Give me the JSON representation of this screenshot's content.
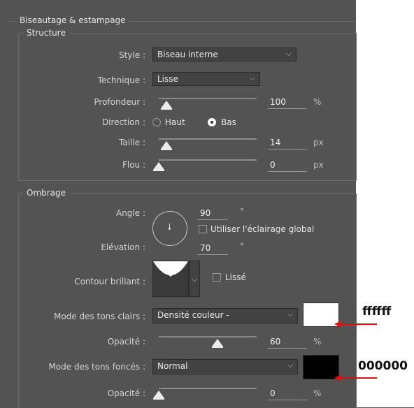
{
  "section": {
    "title": "Biseautage & estampage",
    "structure": {
      "title": "Structure",
      "style_label": "Style :",
      "style_value": "Biseau interne",
      "technique_label": "Technique :",
      "technique_value": "Lisse",
      "profondeur_label": "Profondeur :",
      "profondeur_value": "100",
      "profondeur_unit": "%",
      "profondeur_level": 0.08,
      "direction_label": "Direction :",
      "direction_up": "Haut",
      "direction_down": "Bas",
      "direction_selected": "Bas",
      "taille_label": "Taille :",
      "taille_value": "14",
      "taille_unit": "px",
      "taille_level": 0.08,
      "flou_label": "Flou :",
      "flou_value": "0",
      "flou_unit": "px",
      "flou_level": 0
    },
    "ombrage": {
      "title": "Ombrage",
      "angle_label": "Angle :",
      "angle_value": "90",
      "angle_unit": "°",
      "global_light_label": "Utiliser l'éclairage global",
      "global_light_checked": false,
      "elevation_label": "Elévation :",
      "elevation_value": "70",
      "elevation_unit": "°",
      "contour_label": "Contour brillant :",
      "lisse_label": "Lissé",
      "lisse_checked": false,
      "highlight_mode_label": "Mode des tons clairs :",
      "highlight_mode_value": "Densité couleur -",
      "highlight_color": "#ffffff",
      "highlight_opacity_label": "Opacité :",
      "highlight_opacity_value": "60",
      "highlight_opacity_unit": "%",
      "highlight_opacity_level": 0.6,
      "shadow_mode_label": "Mode des tons foncés :",
      "shadow_mode_value": "Normal",
      "shadow_color": "#000000",
      "shadow_opacity_label": "Opacité :",
      "shadow_opacity_value": "0",
      "shadow_opacity_unit": "%",
      "shadow_opacity_level": 0
    }
  },
  "annotations": {
    "highlight_hex": "ffffff",
    "shadow_hex": "000000",
    "arrow_color": "#e01010"
  }
}
